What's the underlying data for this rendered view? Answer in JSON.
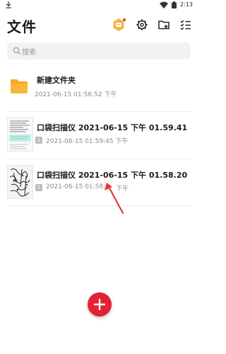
{
  "statusbar": {
    "time": "2:13"
  },
  "header": {
    "title": "文件"
  },
  "search": {
    "placeholder": "搜索"
  },
  "items": [
    {
      "name": "新建文件夹",
      "date": "2021-06-15 01:56:52 下午",
      "type": "folder"
    },
    {
      "name": "口袋扫描仪 2021-06-15 下午 01.59.41",
      "count": "1",
      "date": "2021-06-15 01:59:45 下午",
      "type": "document"
    },
    {
      "name": "口袋扫描仪 2021-06-15 下午 01.58.20",
      "count": "1",
      "date": "2021-06-15 01:58:",
      "date_tail": "下午",
      "type": "document"
    }
  ],
  "colors": {
    "accent": "#e02232",
    "folder": "#f6a623",
    "vip": "#f3b43c",
    "arrow": "#e53935"
  }
}
